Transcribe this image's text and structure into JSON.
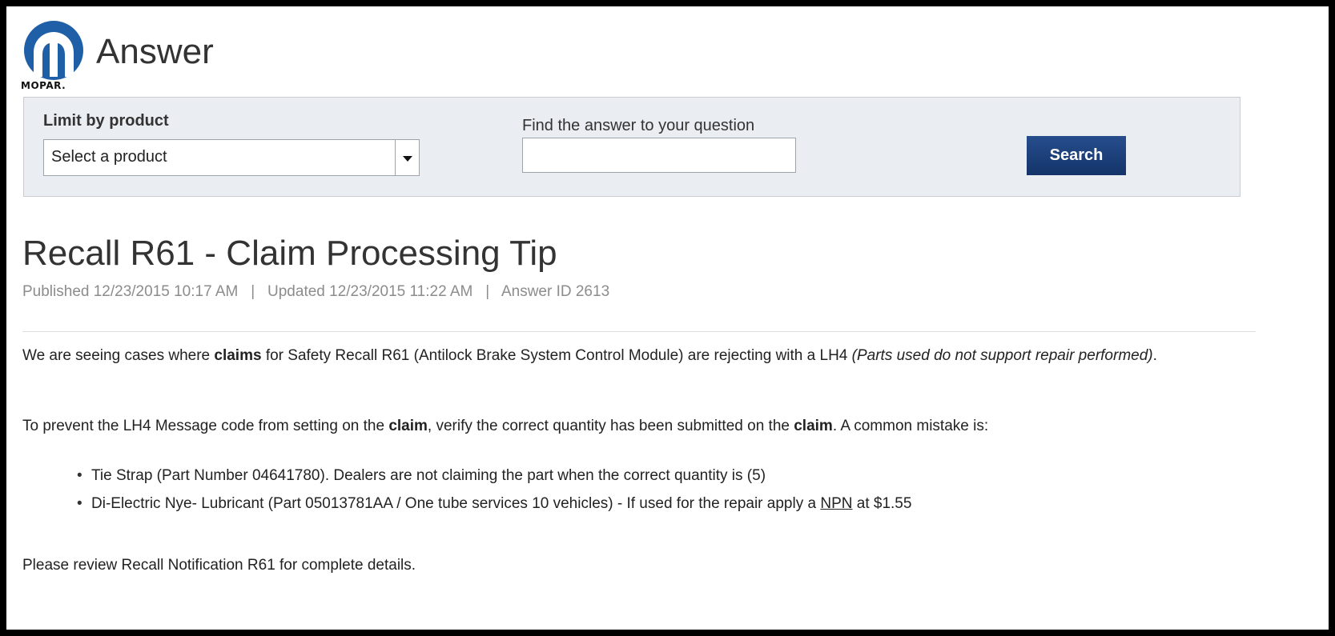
{
  "header": {
    "brand": "MOPAR.",
    "title": "Answer"
  },
  "search_panel": {
    "limit_label": "Limit by product",
    "product_select": {
      "value": "Select a product"
    },
    "query_label": "Find the answer to your question",
    "query_value": "",
    "search_label": "Search"
  },
  "article": {
    "title": "Recall R61 - Claim Processing Tip",
    "published": "Published 12/23/2015 10:17 AM",
    "updated": "Updated 12/23/2015 11:22 AM",
    "answer_id": "Answer ID 2613",
    "meta_separator": "|",
    "p1": {
      "a": "We are seeing cases where ",
      "b": "claims",
      "c": " for Safety Recall R61 (Antilock Brake System Control Module) are rejecting with a LH4 ",
      "d": "(Parts used do not support repair performed)",
      "e": "."
    },
    "p2": {
      "a": "To prevent the LH4 Message code from setting on the ",
      "b": "claim",
      "c": ", verify the correct quantity has been submitted on the ",
      "d": "claim",
      "e": ".  A common mistake is:"
    },
    "bullets": [
      {
        "text": "Tie Strap (Part Number 04641780). Dealers are not claiming the part when the correct quantity is (5)"
      },
      {
        "text": "Di-Electric Nye- Lubricant (Part 05013781AA / One tube services 10 vehicles) - If used for the repair apply a ",
        "link": "NPN",
        "after": " at $1.55"
      }
    ],
    "p3": "Please review Recall Notification R61 for complete details."
  },
  "colors": {
    "brand_blue": "#1f5fa8",
    "button_blue": "#1e3f78",
    "panel_bg": "#eaedf1"
  },
  "icons": {
    "logo": "mopar-m-logo",
    "select_toggle": "chevron-down-icon"
  }
}
